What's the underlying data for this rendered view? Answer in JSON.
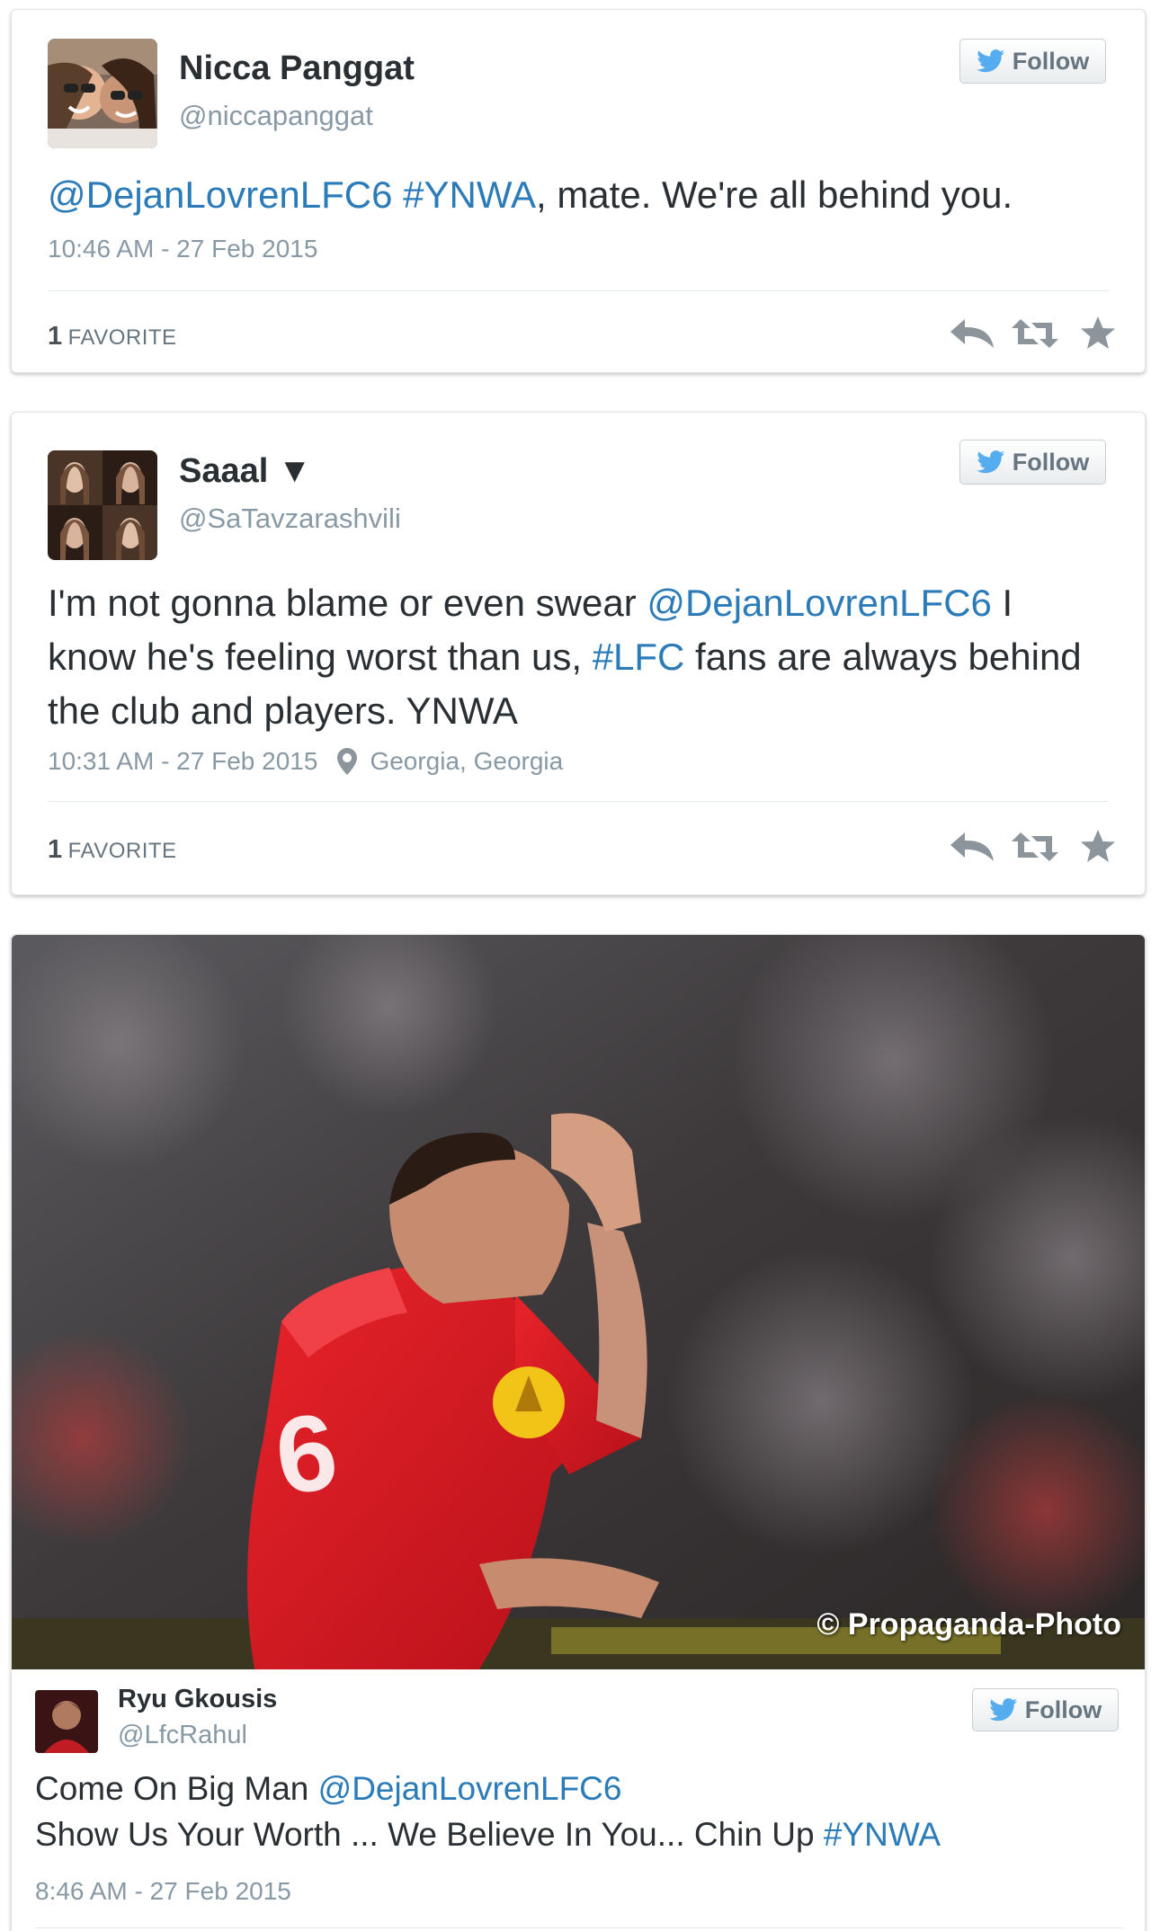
{
  "tweets": [
    {
      "name": "Nicca Panggat",
      "handle": "@niccapanggat",
      "follow_label": "Follow",
      "text": [
        {
          "t": "@DejanLovrenLFC6",
          "link": true
        },
        {
          "t": " ",
          "link": false
        },
        {
          "t": "#YNWA",
          "link": true
        },
        {
          "t": ", mate. We're all behind you.",
          "link": false
        }
      ],
      "time": "10:46 AM - 27 Feb 2015",
      "fav_count": "1",
      "fav_label": "FAVORITE"
    },
    {
      "name": "Saaal ▼",
      "handle": "@SaTavzarashvili",
      "follow_label": "Follow",
      "text": [
        {
          "t": "I'm not gonna blame or even swear ",
          "link": false
        },
        {
          "t": "@DejanLovrenLFC6",
          "link": true
        },
        {
          "t": " I know he's feeling worst than us, ",
          "link": false
        },
        {
          "t": "#LFC",
          "link": true
        },
        {
          "t": " fans are always behind the club and players. YNWA",
          "link": false
        }
      ],
      "time": "10:31 AM - 27 Feb 2015",
      "location": "Georgia, Georgia",
      "fav_count": "1",
      "fav_label": "FAVORITE"
    }
  ],
  "photo_tweet": {
    "photo_credit": "© Propaganda-Photo",
    "name": "Ryu Gkousis",
    "handle": "@LfcRahul",
    "follow_label": "Follow",
    "line1": [
      {
        "t": "Come On Big Man ",
        "link": false
      },
      {
        "t": "@DejanLovrenLFC6",
        "link": true
      }
    ],
    "line2": [
      {
        "t": "Show Us Your Worth ... We Believe In You... Chin Up ",
        "link": false
      },
      {
        "t": "#YNWA",
        "link": true
      }
    ],
    "time": "8:46 AM - 27 Feb 2015"
  },
  "colors": {
    "link": "#2b7bb9",
    "text": "#292f33",
    "muted": "#8899a6",
    "twitter_blue": "#55acee",
    "jersey_red": "#d4141c"
  },
  "icons": [
    "twitter-bird-icon",
    "reply-icon",
    "retweet-icon",
    "favorite-star-icon",
    "location-pin-icon"
  ]
}
